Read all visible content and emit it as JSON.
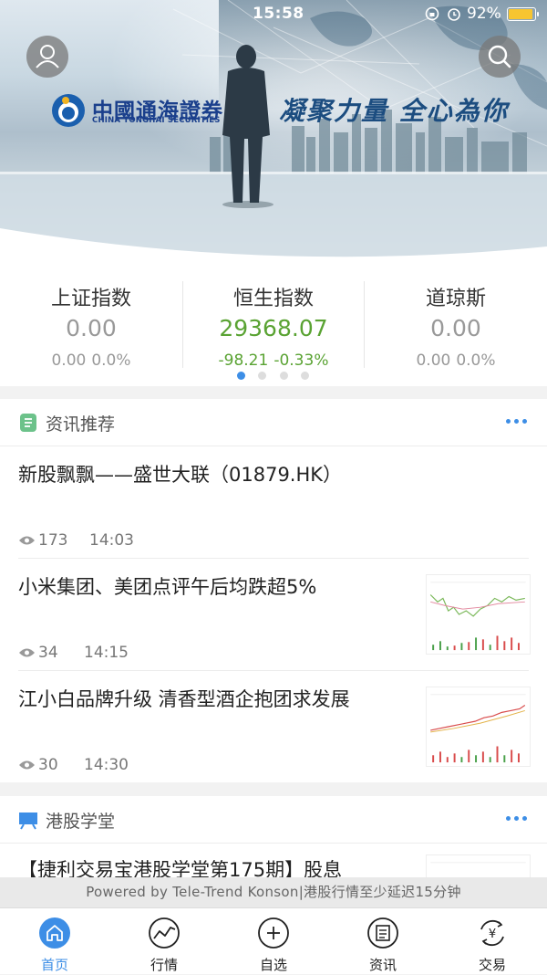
{
  "status_bar": {
    "time": "15:58",
    "battery_percent": "92%"
  },
  "banner": {
    "logo_cn": "中國通海證券",
    "logo_en": "CHINA TONGHAI SECURITIES",
    "slogan": "凝聚力量 全心為你"
  },
  "indices": [
    {
      "name": "上证指数",
      "value": "0.00",
      "change": "0.00",
      "change_pct": "0.0%",
      "trend": "flat"
    },
    {
      "name": "恒生指数",
      "value": "29368.07",
      "change": "-98.21",
      "change_pct": "-0.33%",
      "trend": "down"
    },
    {
      "name": "道琼斯",
      "value": "0.00",
      "change": "0.00",
      "change_pct": "0.0%",
      "trend": "flat"
    }
  ],
  "indices_pager": {
    "pages": 4,
    "active": 0
  },
  "news_section": {
    "title": "资讯推荐",
    "items": [
      {
        "title": "新股飘飘——盛世大联（01879.HK）",
        "views": "173",
        "time": "14:03",
        "has_thumbnail": false
      },
      {
        "title": "小米集团、美团点评午后均跌超5%",
        "views": "34",
        "time": "14:15",
        "has_thumbnail": true
      },
      {
        "title": "江小白品牌升级 清香型酒企抱团求发展",
        "views": "30",
        "time": "14:30",
        "has_thumbnail": true
      }
    ]
  },
  "academy_section": {
    "title": "港股学堂",
    "items": [
      {
        "title": "【捷利交易宝港股学堂第175期】股息"
      }
    ]
  },
  "footer_notice": "Powered by Tele-Trend Konson|港股行情至少延迟15分钟",
  "tabbar": [
    {
      "label": "首页",
      "icon": "home-icon",
      "active": true
    },
    {
      "label": "行情",
      "icon": "market-chart-icon",
      "active": false
    },
    {
      "label": "自选",
      "icon": "add-circle-icon",
      "active": false
    },
    {
      "label": "资讯",
      "icon": "news-icon",
      "active": false
    },
    {
      "label": "交易",
      "icon": "yen-exchange-icon",
      "active": false
    }
  ],
  "colors": {
    "accent": "#3d8ee6",
    "down": "#5aa333",
    "neutral": "#999999",
    "up": "#e03c3c"
  }
}
